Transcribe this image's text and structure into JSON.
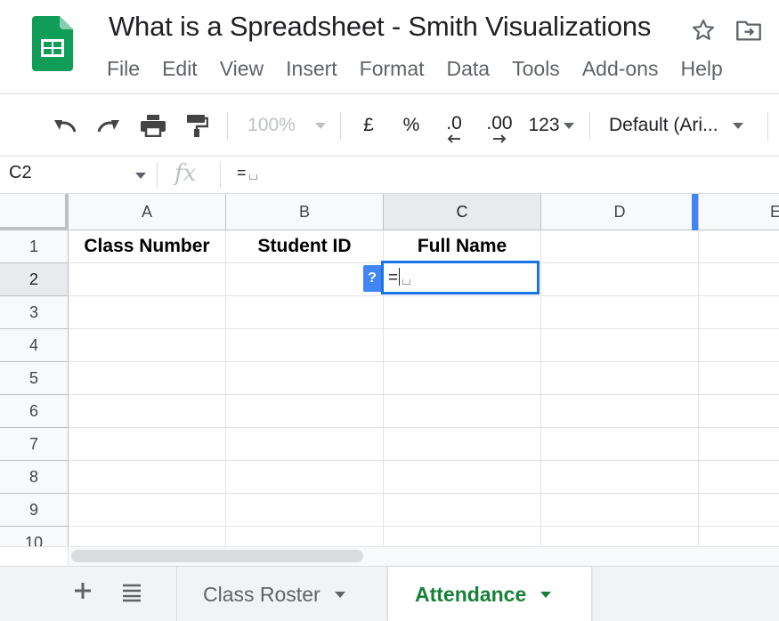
{
  "document": {
    "title": "What is a Spreadsheet - Smith Visualizations",
    "menu": [
      "File",
      "Edit",
      "View",
      "Insert",
      "Format",
      "Data",
      "Tools",
      "Add-ons",
      "Help"
    ]
  },
  "toolbar": {
    "zoom": "100%",
    "currency": "£",
    "percent": "%",
    "decrease_decimal": ".0",
    "increase_decimal": ".00",
    "more_formats": "123",
    "font": "Default (Ari..."
  },
  "formula_bar": {
    "name_box": "C2",
    "fx": "fx",
    "content": "="
  },
  "grid": {
    "columns": [
      "A",
      "B",
      "C",
      "D",
      "E"
    ],
    "rows": [
      "1",
      "2",
      "3",
      "4",
      "5",
      "6",
      "7",
      "8",
      "9",
      "10"
    ],
    "header_row": [
      "Class Number",
      "Student ID",
      "Full Name",
      ""
    ],
    "active_cell": {
      "ref": "C2",
      "content": "="
    },
    "help_chip": "?"
  },
  "sheets": {
    "tabs": [
      {
        "label": "Class Roster",
        "active": false
      },
      {
        "label": "Attendance",
        "active": true
      }
    ]
  },
  "colors": {
    "accent_blue": "#1a73e8",
    "active_tab_green": "#188038",
    "logo_green": "#0f9d58"
  }
}
